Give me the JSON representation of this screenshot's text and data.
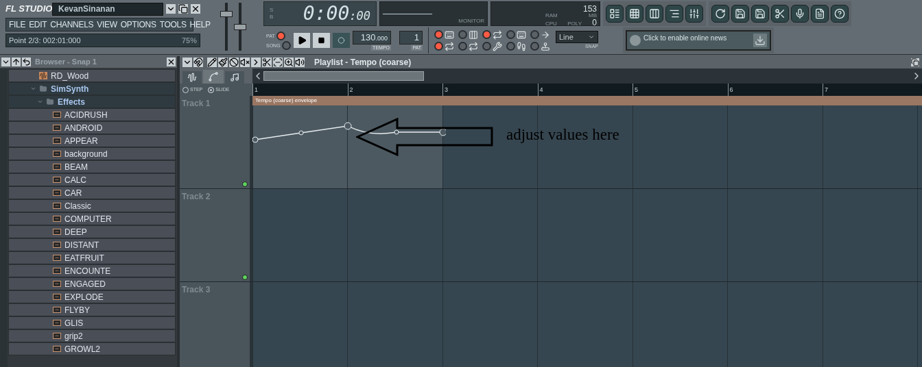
{
  "header": {
    "logo": "FL STUDIO",
    "project": "KevanSinanan"
  },
  "faders": [
    {
      "level": 0.8
    },
    {
      "level": 0.5
    }
  ],
  "menu": [
    "FILE",
    "EDIT",
    "CHANNELS",
    "VIEW",
    "OPTIONS",
    "TOOLS",
    "HELP"
  ],
  "hint_bar": {
    "text": "Point 2/3: 002:01:000",
    "zoom": "75%"
  },
  "time_display": {
    "main": "0:00",
    "sub": ":00",
    "modes": [
      {
        "label": "S",
        "selected": false
      },
      {
        "label": "B",
        "selected": false
      }
    ]
  },
  "monitor": {
    "label": "MONITOR"
  },
  "cpu_panel": {
    "ram": "153",
    "ram_label": "RAM",
    "mb_label": "MB",
    "cpu_label": "CPU",
    "poly_label": "POLY",
    "poly": "0"
  },
  "transport": {
    "modes": [
      {
        "label": "PAT",
        "selected": true
      },
      {
        "label": "SONG",
        "selected": false
      }
    ],
    "tempo": "130",
    "tempo_decimals": ".000",
    "tempo_label": "TEMPO",
    "pattern": "1",
    "pattern_label": "PAT"
  },
  "options": [
    {
      "on": true
    },
    {
      "on": true
    },
    {
      "on": false
    },
    {
      "on": false
    },
    {
      "on": true
    },
    {
      "on": false
    },
    {
      "on": false
    },
    {
      "on": false
    },
    {
      "on": false
    },
    {
      "on": false
    }
  ],
  "snap": {
    "value": "Line",
    "label": "SNAP"
  },
  "news": {
    "text": "Click to enable online news"
  },
  "browser": {
    "title": "Browser - Snap 1",
    "items": [
      {
        "name": "RD_Wood",
        "kind": "sample"
      },
      {
        "name": "SimSynth",
        "kind": "folder",
        "expanded": true,
        "children": [
          {
            "name": "Effects",
            "kind": "folder",
            "expanded": true,
            "children": [
              {
                "name": "ACIDRUSH",
                "kind": "preset"
              },
              {
                "name": "ANDROID",
                "kind": "preset"
              },
              {
                "name": "APPEAR",
                "kind": "preset"
              },
              {
                "name": "background",
                "kind": "preset"
              },
              {
                "name": "BEAM",
                "kind": "preset"
              },
              {
                "name": "CALC",
                "kind": "preset"
              },
              {
                "name": "CAR",
                "kind": "preset"
              },
              {
                "name": "Classic",
                "kind": "preset"
              },
              {
                "name": "COMPUTER",
                "kind": "preset"
              },
              {
                "name": "DEEP",
                "kind": "preset"
              },
              {
                "name": "DISTANT",
                "kind": "preset"
              },
              {
                "name": "EATFRUIT",
                "kind": "preset"
              },
              {
                "name": "ENCOUNTE",
                "kind": "preset"
              },
              {
                "name": "ENGAGED",
                "kind": "preset"
              },
              {
                "name": "EXPLODE",
                "kind": "preset"
              },
              {
                "name": "FLYBY",
                "kind": "preset"
              },
              {
                "name": "GLIS",
                "kind": "preset"
              },
              {
                "name": "grip2",
                "kind": "preset"
              },
              {
                "name": "GROWL2",
                "kind": "preset"
              }
            ]
          }
        ]
      }
    ]
  },
  "playlist": {
    "title": "Playlist - Tempo (coarse)",
    "step_modes": [
      {
        "label": "STEP",
        "selected": false
      },
      {
        "label": "SLIDE",
        "selected": true
      }
    ],
    "ruler": [
      "1",
      "2",
      "3",
      "4",
      "5",
      "6",
      "7"
    ],
    "clip": {
      "label": "Tempo (coarse) envelope"
    },
    "tracks": [
      {
        "name": "Track 1"
      },
      {
        "name": "Track 2"
      },
      {
        "name": "Track 3"
      }
    ]
  },
  "annotation": {
    "text": "adjust values here"
  }
}
